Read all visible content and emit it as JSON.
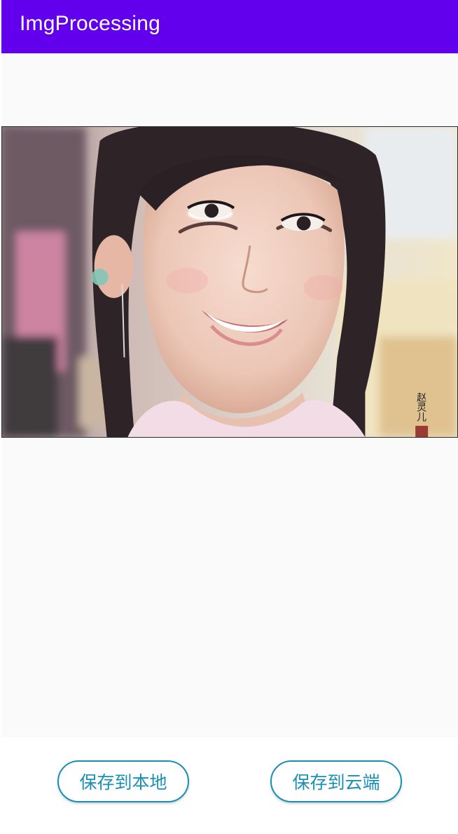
{
  "app_bar": {
    "title": "ImgProcessing",
    "color": "#6200ee"
  },
  "image": {
    "watermark": "赵灵儿"
  },
  "actions": {
    "save_local_label": "保存到本地",
    "save_cloud_label": "保存到云端",
    "accent_color": "#1a8fb5"
  }
}
